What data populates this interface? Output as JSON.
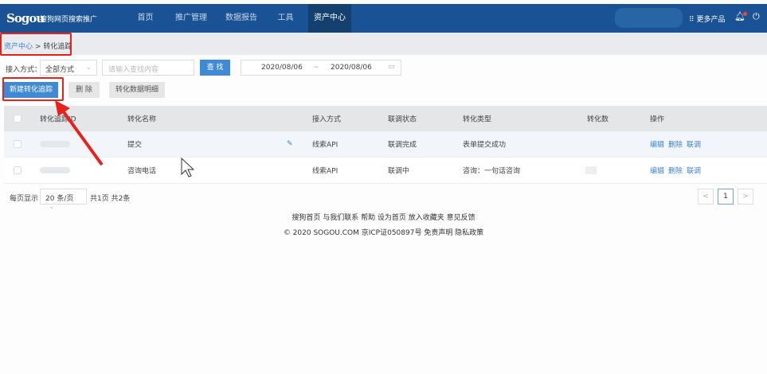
{
  "nav": {
    "logo": "Sogou",
    "logo_sub": "搜狗网页搜索推广",
    "items": [
      "首页",
      "推广管理",
      "数据报告",
      "工具",
      "资产中心"
    ],
    "more_products": "更多产品"
  },
  "breadcrumb": {
    "parent": "资产中心",
    "sep": ">",
    "current": "转化追踪"
  },
  "filters": {
    "access_label": "接入方式：",
    "access_value": "全部方式",
    "search_placeholder": "请输入查找内容",
    "search_button": "查 找",
    "date_start": "2020/08/06",
    "date_sep": "~",
    "date_end": "2020/08/06"
  },
  "actions": {
    "new": "新建转化追踪",
    "delete": "删 除",
    "detail": "转化数据明细"
  },
  "table": {
    "headers": [
      "转化追踪ID",
      "转化名称",
      "接入方式",
      "联调状态",
      "转化类型",
      "转化数",
      "操作"
    ],
    "rows": [
      {
        "name": "提交",
        "access": "线索API",
        "status": "联调完成",
        "type": "表单提交成功"
      },
      {
        "name": "咨询电话",
        "access": "线索API",
        "status": "联调中",
        "type": "咨询：一句话咨询"
      }
    ],
    "ops": [
      "编辑",
      "删除",
      "联调"
    ]
  },
  "pagination": {
    "per_page_label": "每页显示",
    "per_page": "20 条/页",
    "summary": "共1页 共2条",
    "current_page": "1",
    "prev": "<",
    "next": ">"
  },
  "footer": {
    "links": "搜狗首页 与我们联系 帮助 设为首页 放入收藏夹 意见反馈",
    "copyright": "© 2020 SOGOU.COM 京ICP证050897号 免责声明 隐私政策"
  },
  "colors": {
    "nav": "#1a5395",
    "accent": "#3e8ad6",
    "annotation": "#e8211b"
  }
}
